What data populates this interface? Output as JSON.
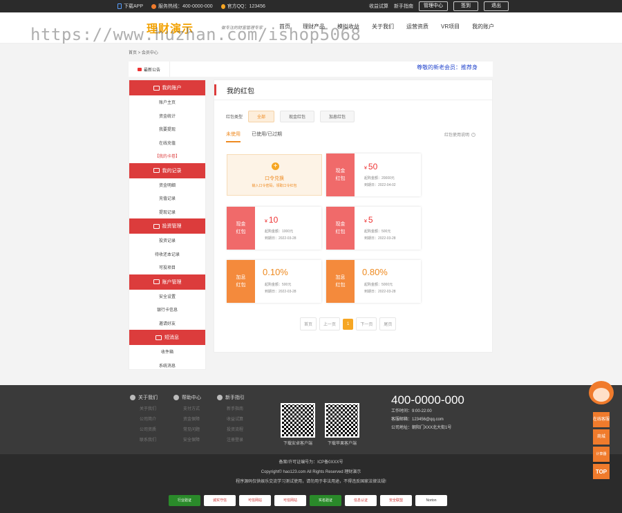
{
  "topbar": {
    "app": "下载APP",
    "hotline": "服务热线：400-0000-000",
    "qq": "官方QQ：123456",
    "links": [
      "收益试算",
      "新手指南"
    ],
    "manage": "管理中心",
    "signin": "签到",
    "logout": "退出"
  },
  "header": {
    "logo": "理财演示",
    "slogan": "做专注的财富管理专家",
    "watermark": "https://www.huzhan.com/ishop5068",
    "nav": [
      "首页",
      "理财产品",
      "模拟收益",
      "关于我们",
      "运营资质",
      "VR项目",
      "我的账户"
    ]
  },
  "breadcrumb": "首页 > 会员中心",
  "notice": {
    "tag": "最新公告",
    "message": "尊敬的新老会员：推荐身"
  },
  "sidebar": {
    "sections": [
      {
        "title": "我的账户",
        "items": [
          "账户主页",
          "资金统计",
          "我要提现",
          "在线充值",
          "【我的卡卷】"
        ]
      },
      {
        "title": "我的记录",
        "items": [
          "资金明细",
          "充值记录",
          "提现记录"
        ]
      },
      {
        "title": "投资管理",
        "items": [
          "投资记录",
          "待收还本记录",
          "可投项目"
        ]
      },
      {
        "title": "账户管理",
        "items": [
          "安全设置",
          "银行卡信息",
          "邀请好友"
        ]
      },
      {
        "title": "短消息",
        "items": [
          "收件箱",
          "系统消息"
        ]
      }
    ]
  },
  "main": {
    "title": "我的红包",
    "filter_label": "红包类型",
    "filters": [
      "全部",
      "现金红包",
      "加息红包"
    ],
    "tabs": [
      "未使用",
      "已使用/已过期"
    ],
    "usage_link": "红包使用说明",
    "redeem": {
      "title": "口令兑换",
      "hint": "输入口令密码，领取口令红包"
    },
    "cards": [
      {
        "type": "现金\n红包",
        "side_color": "red",
        "amount": "50",
        "currency": "¥",
        "cond": "起购金额：20000元",
        "expire": "到期日：2022-04-02"
      },
      {
        "type": "现金\n红包",
        "side_color": "red",
        "amount": "10",
        "currency": "¥",
        "cond": "起购金额：1000元",
        "expire": "到期日：2022-03-28"
      },
      {
        "type": "现金\n红包",
        "side_color": "red",
        "amount": "5",
        "currency": "¥",
        "cond": "起购金额：500元",
        "expire": "到期日：2022-03-28"
      },
      {
        "type": "加息\n红包",
        "side_color": "orange",
        "amount": "0.10%",
        "currency": "",
        "cond": "起购金额：500元",
        "expire": "到期日：2022-03-28"
      },
      {
        "type": "加息\n红包",
        "side_color": "orange",
        "amount": "0.80%",
        "currency": "",
        "cond": "起购金额：5000元",
        "expire": "到期日：2022-03-28"
      }
    ],
    "pager": [
      "首页",
      "上一页",
      "1",
      "下一页",
      "尾页"
    ]
  },
  "footer": {
    "cols": [
      {
        "title": "关于我们",
        "links": [
          "关于我们",
          "公司简介",
          "公司资质",
          "联系我们"
        ]
      },
      {
        "title": "帮助中心",
        "links": [
          "支付方式",
          "资金保障",
          "常见问题",
          "安全保障"
        ]
      },
      {
        "title": "新手指引",
        "links": [
          "新手指南",
          "收益试算",
          "投资流程",
          "注册登录"
        ]
      }
    ],
    "qr": [
      "下载安卓客户端",
      "下载苹果客户端"
    ],
    "tel": "400-0000-000",
    "hours": "工作时间：9:00-22:00",
    "email": "客服邮箱：123456@qq.com",
    "address": "公司地址：朝阳门XXX北大街1号"
  },
  "bottom": {
    "icp": "备案/许可证编号为：ICP备0XXX号",
    "copyright": "Copyright© hao123.com All Rights Reserved 理财演示",
    "disclaimer": "程序源码仅供娱乐交流学习测试使用，请勿用于非法用途，不得违反国家法律法规!",
    "badges": [
      "行业验证",
      "诚实守信",
      "可信网站",
      "可信网站",
      "实名验证",
      "信息认证",
      "安全联盟",
      "Norton"
    ]
  },
  "floating": {
    "service": "在线客服",
    "shop": "商城",
    "calc": "计算器",
    "top": "TOP"
  }
}
